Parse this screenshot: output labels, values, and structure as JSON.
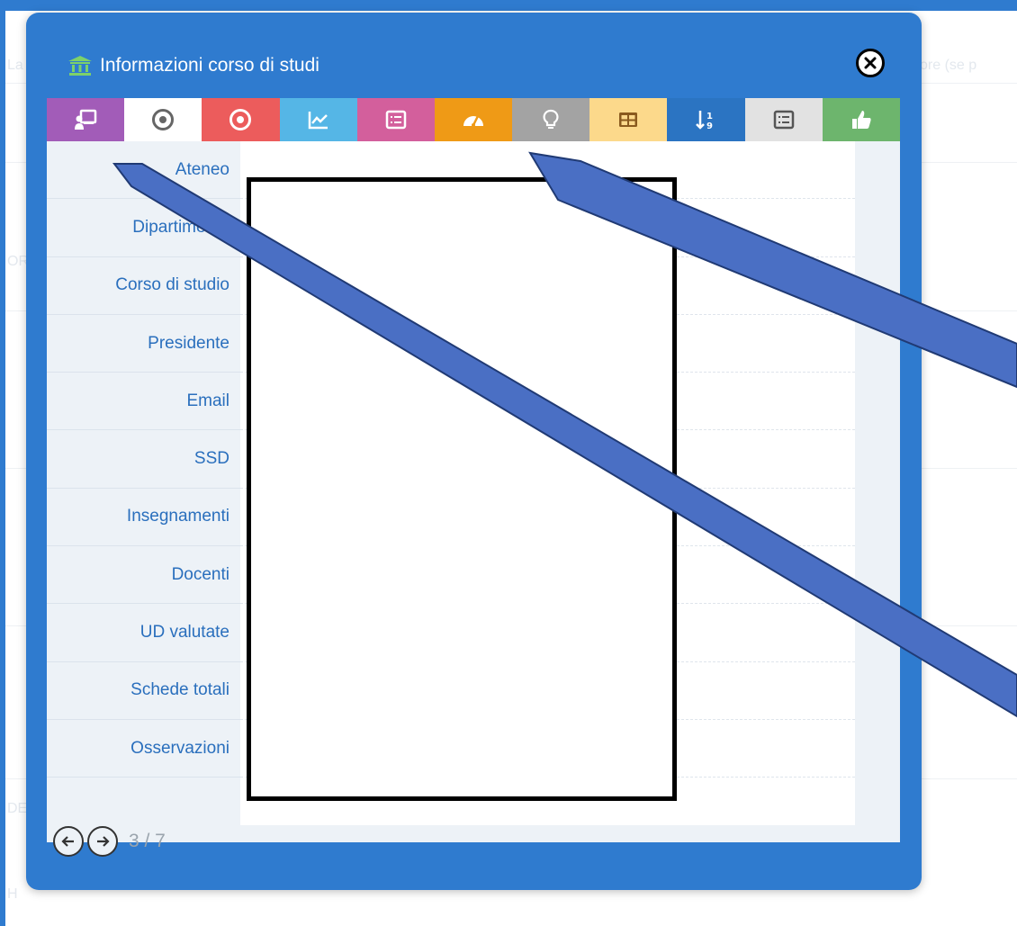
{
  "background": {
    "faint_text_left": "La",
    "faint_text_right": "ore (se p",
    "faint_side_1": "OR",
    "faint_side_2": "DE",
    "faint_side_3": "H"
  },
  "modal": {
    "title": "Informazioni corso di studi",
    "title_icon": "institution-icon",
    "close_icon": "close-circle-icon"
  },
  "tabs": [
    {
      "icon": "presentation-user-icon",
      "color": "#a25cb8"
    },
    {
      "icon": "target-icon",
      "color": "#ffffff"
    },
    {
      "icon": "target-circle-icon",
      "color": "#ec5c5c"
    },
    {
      "icon": "line-chart-icon",
      "color": "#55b6e6"
    },
    {
      "icon": "list-icon",
      "color": "#d35f9c"
    },
    {
      "icon": "dashboard-icon",
      "color": "#ef9a16"
    },
    {
      "icon": "lightbulb-icon",
      "color": "#a3a3a3"
    },
    {
      "icon": "table-icon",
      "color": "#fcd98b"
    },
    {
      "icon": "sort-numeric-icon",
      "color": "#2b74c2"
    },
    {
      "icon": "list-alt-icon",
      "color": "#e2e2e2"
    },
    {
      "icon": "thumbs-up-icon",
      "color": "#6db56d"
    }
  ],
  "fields": [
    {
      "label": "Ateneo"
    },
    {
      "label": "Dipartimento"
    },
    {
      "label": "Corso di studio"
    },
    {
      "label": "Presidente"
    },
    {
      "label": "Email"
    },
    {
      "label": "SSD"
    },
    {
      "label": "Insegnamenti"
    },
    {
      "label": "Docenti"
    },
    {
      "label": "UD valutate"
    },
    {
      "label": "Schede totali"
    },
    {
      "label": "Osservazioni"
    }
  ],
  "pager": {
    "prev_icon": "arrow-left-circle-icon",
    "next_icon": "arrow-right-circle-icon",
    "text": "3 / 7"
  },
  "colors": {
    "modal_blue": "#2f7bcf",
    "annotation_arrow": "#4a6fc4",
    "label_text": "#2a6fbd"
  }
}
